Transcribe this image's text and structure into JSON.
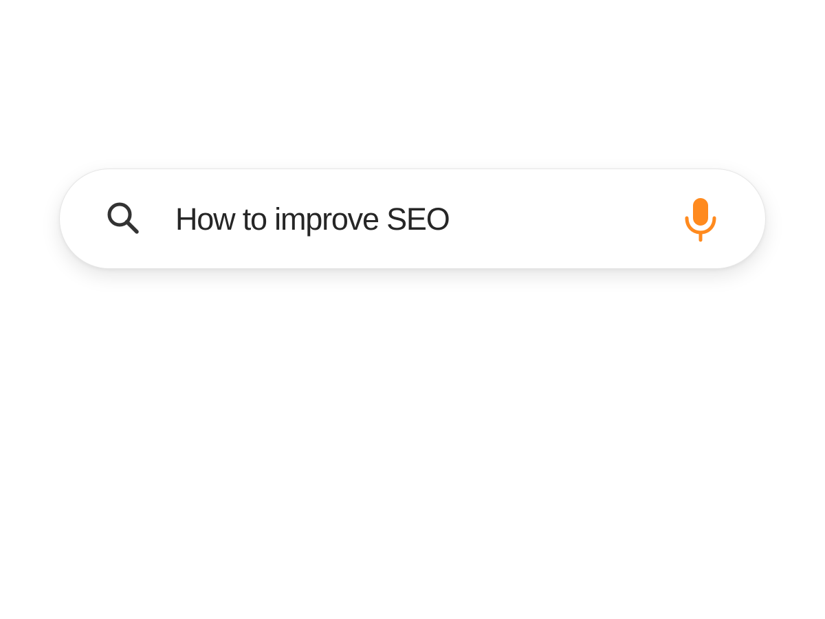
{
  "search": {
    "query": "How to improve SEO",
    "search_icon": "search-icon",
    "mic_icon": "microphone-icon"
  },
  "colors": {
    "background": "#ffffff",
    "bar_background": "#ffffff",
    "text": "#262626",
    "search_icon": "#333333",
    "mic_accent": "#ff8a1e"
  }
}
